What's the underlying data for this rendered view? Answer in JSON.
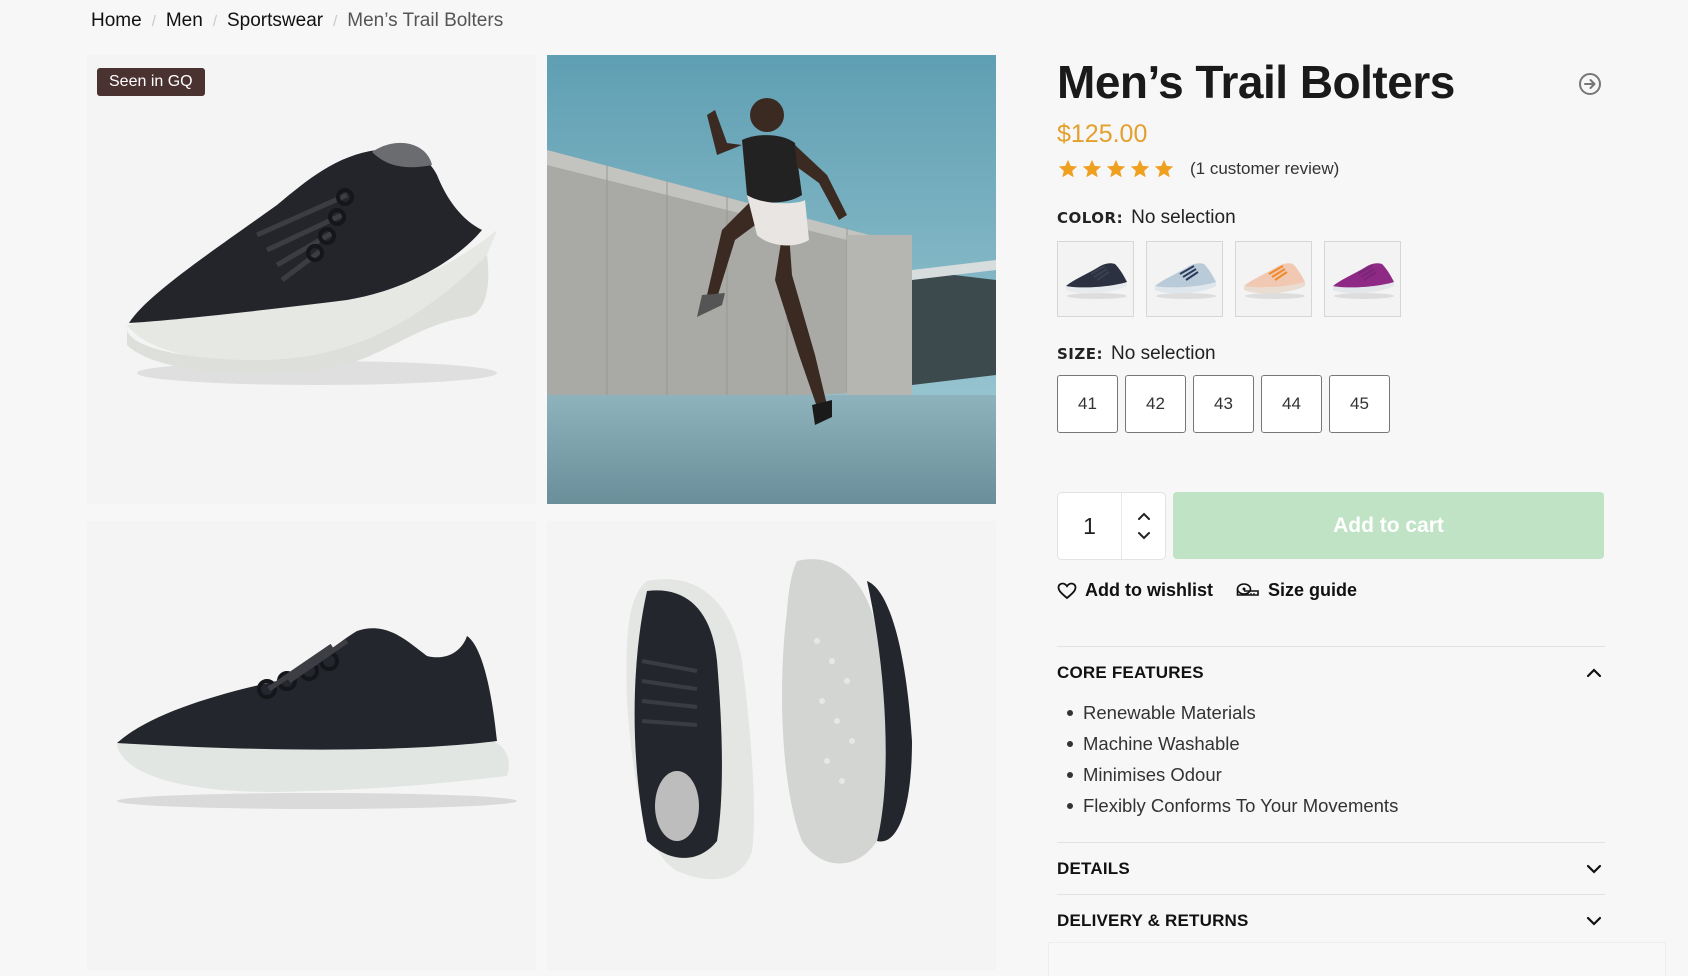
{
  "breadcrumb": {
    "items": [
      "Home",
      "Men",
      "Sportswear"
    ],
    "current": "Men’s Trail Bolters",
    "separator": "/"
  },
  "gallery": {
    "badge": "Seen in GQ",
    "images": [
      {
        "alt": "Charcoal trail bolter side-angle view",
        "icon": "shoe-angle-image"
      },
      {
        "alt": "Athlete jumping in front of concrete wall",
        "icon": "lifestyle-photo"
      },
      {
        "alt": "Charcoal trail bolter side profile",
        "icon": "shoe-profile-image"
      },
      {
        "alt": "Pair of trail bolters top and sole view",
        "icon": "shoe-pair-image"
      }
    ]
  },
  "product": {
    "title": "Men’s Trail Bolters",
    "price": "$125.00",
    "rating": {
      "value": 5,
      "max": 5,
      "review_text": "(1 customer review)"
    },
    "color": {
      "label": "COLOR:",
      "value": "No selection",
      "options": [
        {
          "name": "Navy",
          "upper": "#2b3140",
          "sole": "#e8ebee",
          "lace": "#3a4050"
        },
        {
          "name": "Light Blue",
          "upper": "#b9cad8",
          "sole": "#dfe6ec",
          "lace": "#2c3b5c"
        },
        {
          "name": "Peach",
          "upper": "#f1c9b3",
          "sole": "#e9ddd2",
          "lace": "#f08a2c"
        },
        {
          "name": "Purple",
          "upper": "#8e2a86",
          "sole": "#e4e7ea",
          "lace": "#7a2575"
        }
      ]
    },
    "size": {
      "label": "SIZE:",
      "value": "No selection",
      "options": [
        "41",
        "42",
        "43",
        "44",
        "45"
      ]
    },
    "quantity": "1",
    "add_to_cart": "Add to cart",
    "wishlist": "Add to wishlist",
    "size_guide": "Size guide"
  },
  "accordions": {
    "core": {
      "title": "CORE FEATURES",
      "expanded": true,
      "items": [
        "Renewable Materials",
        "Machine Washable",
        "Minimises Odour",
        "Flexibly Conforms To Your Movements"
      ]
    },
    "details": {
      "title": "DETAILS",
      "expanded": false
    },
    "delivery": {
      "title": "DELIVERY & RETURNS",
      "expanded": false
    }
  },
  "colors": {
    "price": "#e3a02c",
    "star": "#f0a020",
    "badge_bg": "#4a3230",
    "cart_button": "#bfe3c4"
  }
}
